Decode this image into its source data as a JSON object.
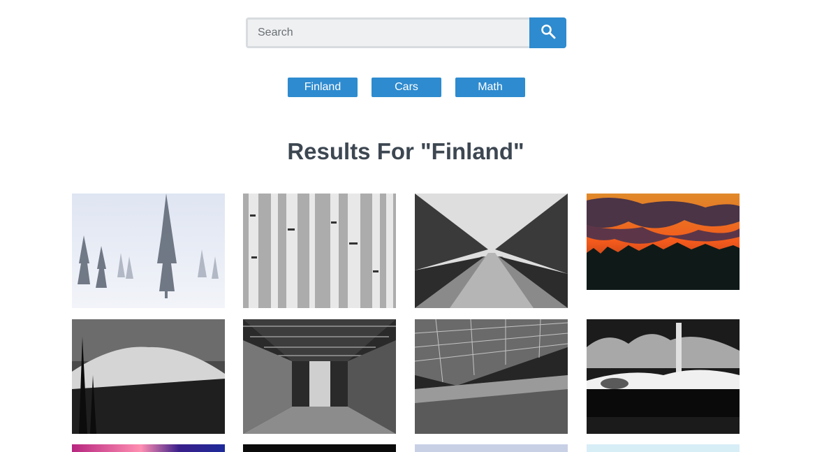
{
  "search": {
    "placeholder": "Search",
    "value": ""
  },
  "chips": [
    {
      "label": "Finland"
    },
    {
      "label": "Cars"
    },
    {
      "label": "Math"
    }
  ],
  "results": {
    "title": "Results For \"Finland\""
  },
  "images": [
    {
      "name": "image-snowy-forest",
      "subject": "snowy trees in fog"
    },
    {
      "name": "image-birch-forest",
      "subject": "birch tree trunks"
    },
    {
      "name": "image-canal-trees",
      "subject": "canal lined with trees"
    },
    {
      "name": "image-sunset-sky",
      "subject": "orange sunset over forest"
    },
    {
      "name": "image-fell-mountain",
      "subject": "snowy fell and forest"
    },
    {
      "name": "image-station-hall",
      "subject": "train station hall interior"
    },
    {
      "name": "image-station-platform",
      "subject": "train station platform"
    },
    {
      "name": "image-chimney-building",
      "subject": "building with chimney"
    },
    {
      "name": "image-neon-lights",
      "subject": "colorful lights"
    },
    {
      "name": "image-dark",
      "subject": "dark image"
    },
    {
      "name": "image-pale-sky",
      "subject": "pale sky"
    },
    {
      "name": "image-light-blue",
      "subject": "light blue sky"
    }
  ],
  "colors": {
    "accent": "#2e8bcf",
    "title": "#3d4752",
    "input_bg": "#eef0f2",
    "input_border": "#d8dcdf"
  }
}
